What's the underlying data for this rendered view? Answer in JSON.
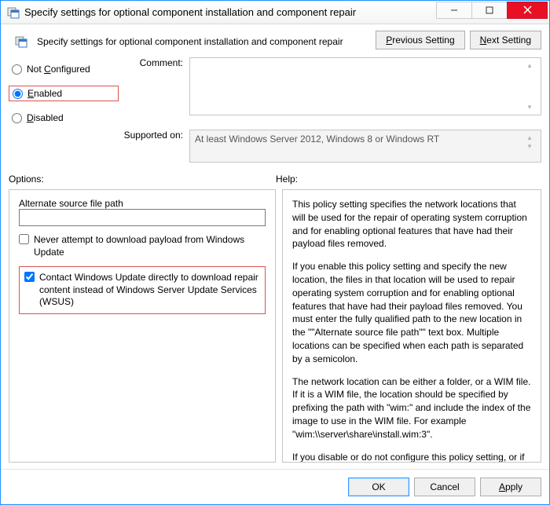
{
  "window": {
    "title": "Specify settings for optional component installation and component repair"
  },
  "header": {
    "subtitle": "Specify settings for optional component installation and component repair",
    "previous_btn": {
      "pre": "",
      "ul": "P",
      "post": "revious Setting"
    },
    "next_btn": {
      "pre": "",
      "ul": "N",
      "post": "ext Setting"
    }
  },
  "state": {
    "not_configured": {
      "pre": "Not ",
      "ul": "C",
      "post": "onfigured"
    },
    "enabled": {
      "pre": "",
      "ul": "E",
      "post": "nabled"
    },
    "disabled": {
      "pre": "",
      "ul": "D",
      "post": "isabled"
    },
    "selected": "enabled"
  },
  "labels": {
    "comment": "Comment:",
    "supported_on": "Supported on:",
    "options": "Options:",
    "help": "Help:"
  },
  "fields": {
    "comment_value": "",
    "supported_value": "At least Windows Server 2012, Windows 8 or Windows RT"
  },
  "options": {
    "alt_path_label": "Alternate source file path",
    "alt_path_value": "",
    "never_download_label": "Never attempt to download payload from Windows Update",
    "never_download_checked": false,
    "contact_wu_label": "Contact Windows Update directly to download repair content instead of Windows Server Update Services (WSUS)",
    "contact_wu_checked": true
  },
  "help": {
    "p1": "This policy setting specifies the network locations that will be used for the repair of operating system corruption and for enabling optional features that have had their payload files removed.",
    "p2": "If you enable this policy setting and specify the new location, the files in that location will be used to repair operating system corruption and for enabling optional features that have had their payload files removed. You must enter the fully qualified path to the new location in the \"\"Alternate source file path\"\" text box. Multiple locations can be specified when each path is separated by a semicolon.",
    "p3": "The network location can be either a folder, or a WIM file. If it is a WIM file, the location should be specified by prefixing the path with \"wim:\" and include the index of the image to use in the WIM file. For example \"wim:\\\\server\\share\\install.wim:3\".",
    "p4": "If you disable or do not configure this policy setting, or if the required files cannot be found at the locations specified in this"
  },
  "footer": {
    "ok": "OK",
    "cancel": "Cancel",
    "apply": {
      "ul": "A",
      "post": "pply"
    }
  }
}
